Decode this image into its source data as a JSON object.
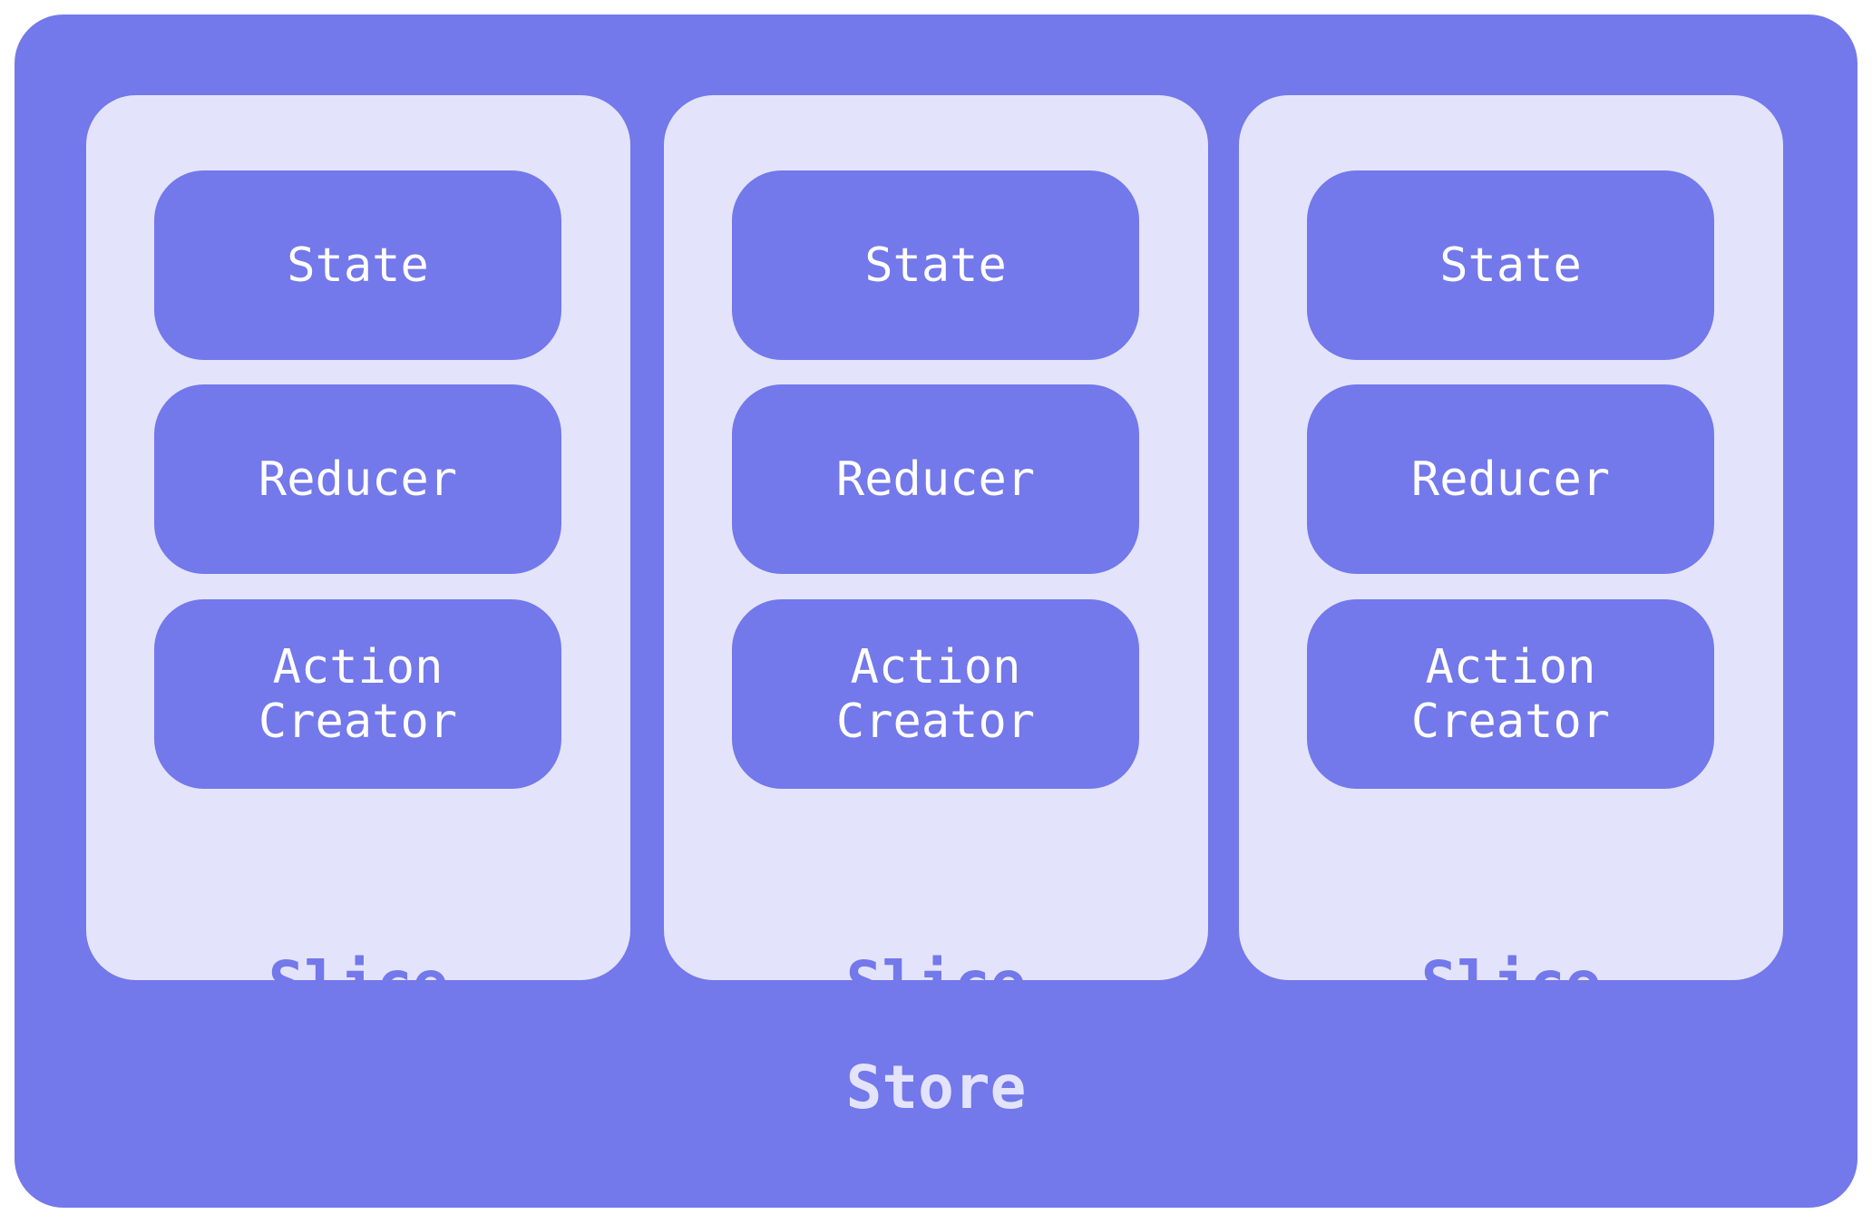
{
  "store": {
    "label": "Store"
  },
  "slices": [
    {
      "label": "Slice",
      "items": [
        "State",
        "Reducer",
        "Action\nCreator"
      ]
    },
    {
      "label": "Slice",
      "items": [
        "State",
        "Reducer",
        "Action\nCreator"
      ]
    },
    {
      "label": "Slice",
      "items": [
        "State",
        "Reducer",
        "Action\nCreator"
      ]
    }
  ],
  "colors": {
    "primary": "#7378ea",
    "light": "#e3e4fb",
    "text": "#ffffff"
  }
}
